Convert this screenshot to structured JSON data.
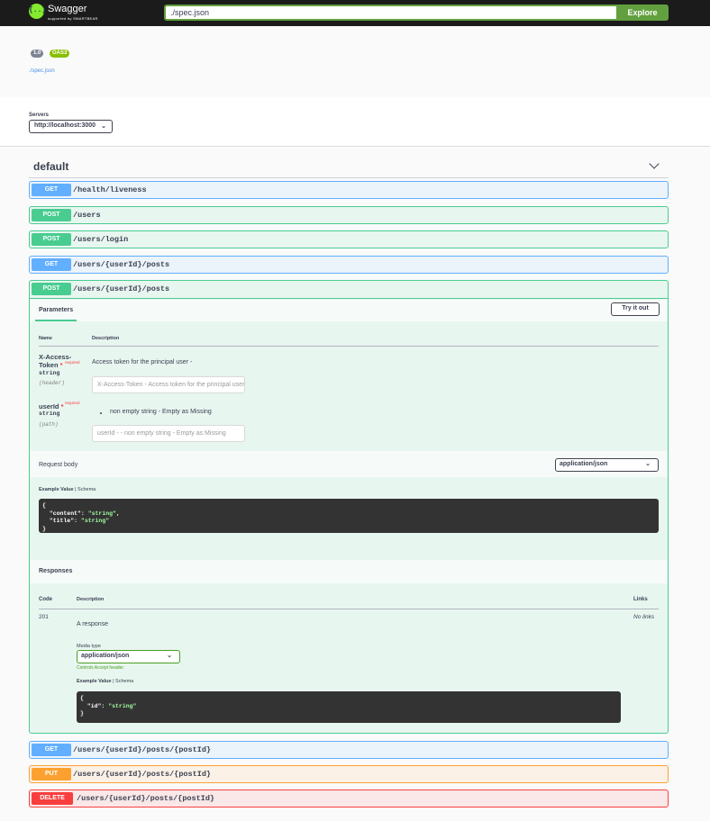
{
  "topbar": {
    "logo_glyph": "{..}",
    "brand": "Swagger",
    "brand_sub": "supported by SMARTBEAR",
    "url_value": "./spec.json",
    "explore_label": "Explore"
  },
  "info": {
    "version": "1.0",
    "oas": "OAS3",
    "spec_link": "./spec.json"
  },
  "servers": {
    "label": "Servers",
    "selected": "http://localhost:3000"
  },
  "tag": {
    "name": "default"
  },
  "operations": [
    {
      "method": "GET",
      "path": "/health/liveness"
    },
    {
      "method": "POST",
      "path": "/users"
    },
    {
      "method": "POST",
      "path": "/users/login"
    },
    {
      "method": "GET",
      "path": "/users/{userId}/posts"
    },
    {
      "method": "POST",
      "path": "/users/{userId}/posts"
    },
    {
      "method": "GET",
      "path": "/users/{userId}/posts/{postId}"
    },
    {
      "method": "PUT",
      "path": "/users/{userId}/posts/{postId}"
    },
    {
      "method": "DELETE",
      "path": "/users/{userId}/posts/{postId}"
    }
  ],
  "expanded": {
    "parameters_title": "Parameters",
    "try_it_out": "Try it out",
    "col_name": "Name",
    "col_description": "Description",
    "params": [
      {
        "name_line1": "X-Access-",
        "name_line2": "Token",
        "required_mark": "*",
        "required": "required",
        "type": "string",
        "in": "(header)",
        "description": "Access token for the principal user -",
        "placeholder": "X-Access-Token - Access token for the principal user -"
      },
      {
        "name_line1": "userId",
        "required_mark": "*",
        "required": "required",
        "type": "string",
        "in": "(path)",
        "description": "non empty string - Empty as Missing",
        "placeholder": "userId -  - non empty string - Empty as Missing"
      }
    ],
    "request_body_label": "Request body",
    "request_content_type": "application/json",
    "example_value_tab": "Example Value",
    "tab_separator": "|",
    "schema_tab": "Schema",
    "request_example": {
      "open": "{",
      "line1_key": "  \"content\": ",
      "line1_val": "\"string\"",
      "line1_end": ",",
      "line2_key": "  \"title\": ",
      "line2_val": "\"string\"",
      "close": "}"
    },
    "responses_title": "Responses",
    "col_code": "Code",
    "col_resp_description": "Description",
    "col_links": "Links",
    "response": {
      "code": "201",
      "description": "A response",
      "links": "No links",
      "media_type_label": "Media type",
      "media_type": "application/json",
      "controls_note": "Controls Accept header.",
      "example": {
        "open": "{",
        "line1_key": "  \"id\": ",
        "line1_val": "\"string\"",
        "close": "}"
      }
    }
  }
}
